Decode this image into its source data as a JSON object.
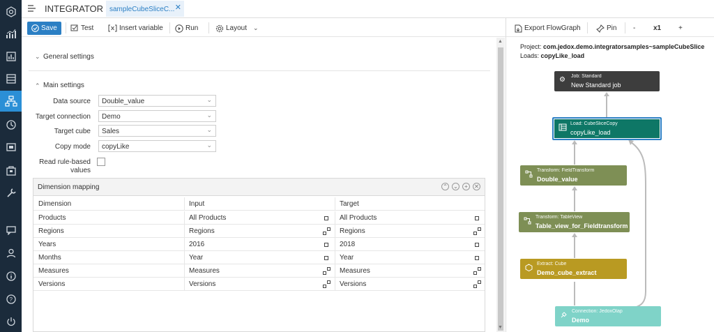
{
  "app": {
    "title": "INTEGRATOR",
    "tab_label": "sampleCubeSliceC..."
  },
  "toolbar": {
    "save": "Save",
    "test": "Test",
    "insert_variable": "Insert variable",
    "run": "Run",
    "layout": "Layout"
  },
  "right_toolbar": {
    "export": "Export FlowGraph",
    "pin": "Pin",
    "zoom_out": "-",
    "zoom": "x1",
    "zoom_in": "+"
  },
  "sections": {
    "general": "General settings",
    "main": "Main settings"
  },
  "form": {
    "data_source_label": "Data source",
    "data_source": "Double_value",
    "target_connection_label": "Target connection",
    "target_connection": "Demo",
    "target_cube_label": "Target cube",
    "target_cube": "Sales",
    "copy_mode_label": "Copy mode",
    "copy_mode": "copyLike",
    "read_rule_label_1": "Read rule-based",
    "read_rule_label_2": "values"
  },
  "dimension_mapping": {
    "title": "Dimension mapping",
    "headers": [
      "Dimension",
      "Input",
      "Target"
    ],
    "rows": [
      {
        "dimension": "Products",
        "input": "All Products",
        "target": "All Products"
      },
      {
        "dimension": "Regions",
        "input": "Regions",
        "target": "Regions"
      },
      {
        "dimension": "Years",
        "input": "2016",
        "target": "2018"
      },
      {
        "dimension": "Months",
        "input": "Year",
        "target": "Year"
      },
      {
        "dimension": "Measures",
        "input": "Measures",
        "target": "Measures"
      },
      {
        "dimension": "Versions",
        "input": "Versions",
        "target": "Versions"
      }
    ]
  },
  "flow": {
    "project_label": "Project:",
    "project": "com.jedox.demo.integratorsamples~sampleCubeSliceCo",
    "loads_label": "Loads:",
    "loads": "copyLike_load",
    "nodes": [
      {
        "type": "Job: Standard",
        "name": "New Standard job",
        "color": "#3d3d3d"
      },
      {
        "type": "Load: CubeSliceCopy",
        "name": "copyLike_load",
        "color": "#0e7766"
      },
      {
        "type": "Transform: FieldTransform",
        "name": "Double_value",
        "color": "#7e8f55"
      },
      {
        "type": "Transform: TableView",
        "name": "Table_view_for_Fieldtransform",
        "color": "#7e8f55"
      },
      {
        "type": "Extract: Cube",
        "name": "Demo_cube_extract",
        "color": "#b99a22"
      },
      {
        "type": "Connection: JedoxOlap",
        "name": "Demo",
        "color": "#7fd3c8"
      }
    ]
  },
  "colors": {
    "accent": "#2b7fc4",
    "nav": "#1b2b3b"
  }
}
